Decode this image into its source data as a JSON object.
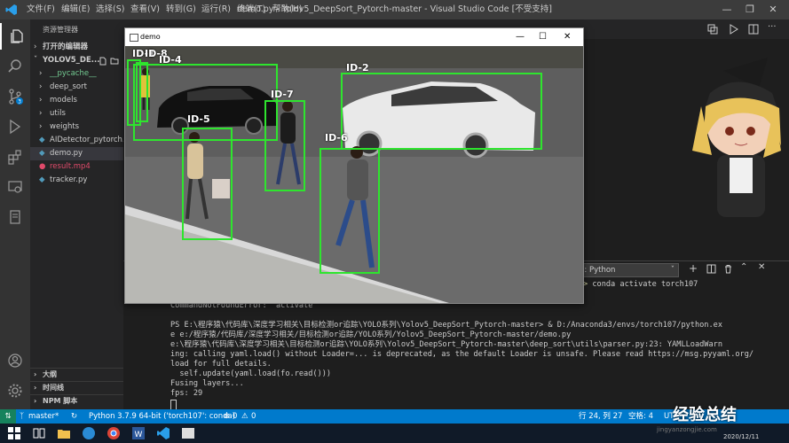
{
  "titlebar": {
    "menus": [
      "文件(F)",
      "编辑(E)",
      "选择(S)",
      "查看(V)",
      "转到(G)",
      "运行(R)",
      "终端(T)",
      "帮助(H)"
    ],
    "title": "demo.py - Yolov5_DeepSort_Pytorch-master - Visual Studio Code [不受支持]"
  },
  "sidebar": {
    "header": "资源管理器",
    "open_editors": "打开的编辑器",
    "project": "YOLOV5_DE...",
    "items": [
      {
        "label": "__pycache__",
        "type": "folder"
      },
      {
        "label": "deep_sort",
        "type": "folder"
      },
      {
        "label": "models",
        "type": "folder"
      },
      {
        "label": "utils",
        "type": "folder"
      },
      {
        "label": "weights",
        "type": "folder"
      },
      {
        "label": "AIDetector_pytorch.p...",
        "type": "py"
      },
      {
        "label": "demo.py",
        "type": "py"
      },
      {
        "label": "result.mp4",
        "type": "mp4"
      },
      {
        "label": "tracker.py",
        "type": "py"
      }
    ],
    "sections": [
      "大纲",
      "时间线",
      "NPM 脚本"
    ]
  },
  "demo_window": {
    "title": "demo",
    "detections": [
      {
        "label": "ID-1"
      },
      {
        "label": "ID-8"
      },
      {
        "label": "ID-4"
      },
      {
        "label": "ID-2"
      },
      {
        "label": "ID-7"
      },
      {
        "label": "ID-5"
      },
      {
        "label": "ID-6"
      }
    ]
  },
  "terminal": {
    "shell_select": "2: Python",
    "prompt_cmd": "conda activate torch107",
    "lines": [
      "CommandNotFoundError: 'activate'",
      "",
      "PS E:\\程序猿\\代码库\\深度学习相关\\目标检测or追踪\\YOLO系列\\Yolov5_DeepSort_Pytorch-master> & D:/Anaconda3/envs/torch107/python.ex",
      "e e:/程序猿/代码库/深度学习相关/目标检测or追踪/YOLO系列/Yolov5_DeepSort_Pytorch-master/demo.py",
      "e:\\程序猿\\代码库\\深度学习相关\\目标检测or追踪\\YOLO系列\\Yolov5_DeepSort_Pytorch-master\\deep_sort\\utils\\parser.py:23: YAMLLoadWarn",
      "ing: calling yaml.load() without Loader=... is deprecated, as the default Loader is unsafe. Please read https://msg.pyyaml.org/",
      "load for full details.",
      "  self.update(yaml.load(fo.read()))",
      "Fusing layers...",
      "fps: 29"
    ]
  },
  "status": {
    "branch": "master*",
    "interpreter": "Python 3.7.9 64-bit ('torch107': conda)",
    "errors": "0",
    "warnings": "0",
    "position": "行 24, 列 27",
    "spaces": "空格: 4",
    "encoding": "UT"
  },
  "watermark": {
    "text": "经验总结",
    "url": "jingyanzongjie.com",
    "date": "2020/12/11"
  },
  "colors": {
    "accent": "#007acc",
    "box": "#2ee52e"
  }
}
